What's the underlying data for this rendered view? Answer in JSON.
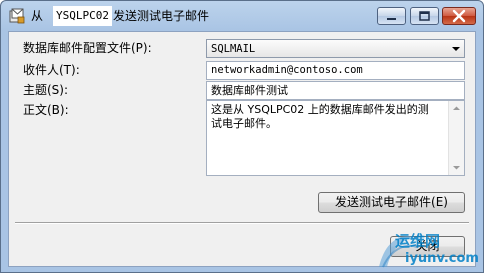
{
  "window": {
    "title_prefix": "从 ",
    "title_server": "YSQLPC02",
    "title_suffix": "发送测试电子邮件"
  },
  "form": {
    "profile_label": "数据库邮件配置文件(P):",
    "profile_value": "SQLMAIL",
    "recipients_label": "收件人(T):",
    "recipients_value": "networkadmin@contoso.com",
    "subject_label": "主题(S):",
    "subject_value": "数据库邮件测试",
    "body_label": "正文(B):",
    "body_value": "这是从 YSQLPC02 上的数据库邮件发出的测试电子邮件。"
  },
  "buttons": {
    "send_label": "发送测试电子邮件(E)",
    "close_label": "关闭"
  },
  "watermark": {
    "line1": "运维网",
    "line2": "iyunv.com"
  },
  "icons": {
    "app": "mail-app-icon",
    "minimize": "minimize-icon",
    "maximize": "maximize-icon",
    "close": "close-icon",
    "dropdown": "chevron-down-icon",
    "scroll_up": "scroll-up-icon",
    "scroll_down": "scroll-down-icon"
  }
}
